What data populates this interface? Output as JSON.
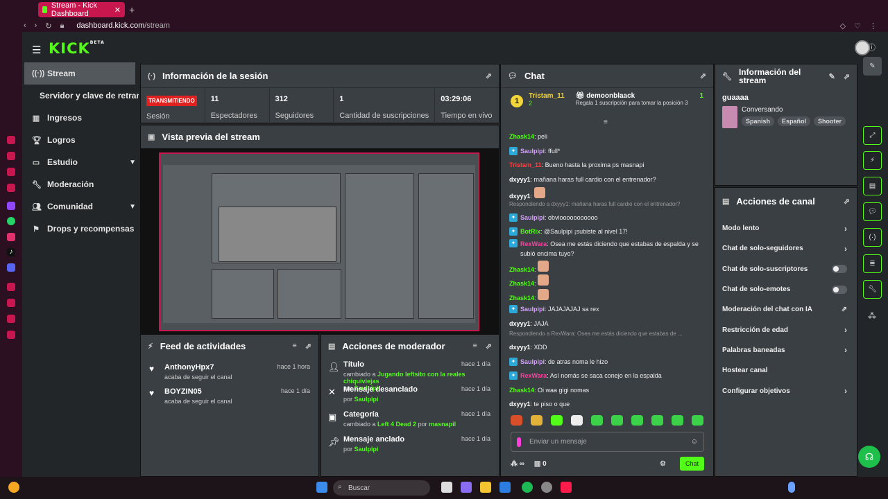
{
  "browser": {
    "tab_title": "Stream - Kick Dashboard",
    "url_host": "dashboard.kick.com",
    "url_path": "/stream"
  },
  "app": {
    "logo": "KICK",
    "logo_badge": "BETA"
  },
  "nav": {
    "stream": "Stream",
    "stream_sub": "Servidor y clave de retransmisión",
    "ingresos": "Ingresos",
    "logros": "Logros",
    "estudio": "Estudio",
    "moderacion": "Moderación",
    "comunidad": "Comunidad",
    "drops": "Drops y recompensas"
  },
  "session": {
    "title": "Información de la sesión",
    "live_badge": "TRANSMITIENDO",
    "live_label": "Sesión",
    "viewers": "11",
    "viewers_label": "Espectadores",
    "followers": "312",
    "followers_label": "Seguidores",
    "subs": "1",
    "subs_label": "Cantidad de suscripciones",
    "time": "03:29:06",
    "time_label": "Tiempo en vivo"
  },
  "preview": {
    "title": "Vista previa del stream"
  },
  "feed": {
    "title": "Feed de actividades",
    "items": [
      {
        "name": "AnthonyHpx7",
        "sub": "acaba de seguir el canal",
        "time": "hace 1 hora"
      },
      {
        "name": "BOYZIN05",
        "sub": "acaba de seguir el canal",
        "time": "hace 1 día"
      }
    ]
  },
  "modactions": {
    "title": "Acciones de moderador",
    "items": [
      {
        "title": "Título",
        "pre": "cambiado a ",
        "val": "Jugando leftsito con la reales chiquiviejas",
        "by": "Saulpipi",
        "time": "hace 1 día"
      },
      {
        "title": "Mensaje desanclado",
        "pre": "",
        "val": "",
        "by": "Saulpipi",
        "time": "hace 1 día"
      },
      {
        "title": "Categoría",
        "pre": "cambiado a ",
        "val": "Left 4 Dead 2",
        "by": "masnapil",
        "time": "hace 1 día"
      },
      {
        "title": "Mensaje anclado",
        "pre": "",
        "val": "",
        "by": "Saulpipi",
        "time": "hace 1 día"
      }
    ],
    "by_label": "por"
  },
  "chat": {
    "title": "Chat",
    "pinned": {
      "rank": "1",
      "user": "Tristam_11",
      "subcount": "2",
      "gifter": "demoonblaack",
      "gift_count": "1",
      "gift_text": "Regala 1 suscripción para tomar la posición 3"
    },
    "messages": [
      {
        "user": "Zhask14",
        "color": "#53fc18",
        "badge": false,
        "text": "peli"
      },
      {
        "user": "Saulpipi",
        "color": "#d6a0ff",
        "badge": true,
        "text": "ffull*"
      },
      {
        "user": "Tristam_11",
        "color": "#ff3f3f",
        "badge": false,
        "text": "Bueno hasta la proxima ps masnapi"
      },
      {
        "user": "dxyyy1",
        "color": "#ffffff",
        "badge": false,
        "text": "mañana haras full cardio con el entrenador?"
      },
      {
        "user": "dxyyy1",
        "color": "#ffffff",
        "badge": false,
        "text": "",
        "emote": true
      },
      {
        "reply": "Respondiendo a dxyyy1: mañana haras full cardio con el entrenador?"
      },
      {
        "user": "Saulpipi",
        "color": "#d6a0ff",
        "badge": true,
        "text": "obviooooooooooo"
      },
      {
        "user": "BotRix",
        "color": "#53fc18",
        "badge": true,
        "text": "@Saulpipi ¡subiste al nivel 17!"
      },
      {
        "user": "RexWara",
        "color": "#ff3fa0",
        "badge": true,
        "text": "Osea me estás diciendo que estabas de espalda y se subió encima tuyo?",
        "two": true
      },
      {
        "user": "Zhask14",
        "color": "#53fc18",
        "badge": false,
        "text": "",
        "emote": true
      },
      {
        "user": "Zhask14",
        "color": "#53fc18",
        "badge": false,
        "text": "",
        "emote": true
      },
      {
        "user": "Zhask14",
        "color": "#53fc18",
        "badge": false,
        "text": "",
        "emote": true
      },
      {
        "user": "Saulpipi",
        "color": "#d6a0ff",
        "badge": true,
        "text": "JAJAJAJAJ sa rex"
      },
      {
        "user": "dxyyy1",
        "color": "#ffffff",
        "badge": false,
        "text": "JAJA"
      },
      {
        "reply": "Respondiendo a RexWara: Osea me estás diciendo que estabas de ..."
      },
      {
        "user": "dxyyy1",
        "color": "#ffffff",
        "badge": false,
        "text": "XDD"
      },
      {
        "user": "Saulpipi",
        "color": "#d6a0ff",
        "badge": true,
        "text": "de atras noma le hizo"
      },
      {
        "user": "RexWara",
        "color": "#ff3fa0",
        "badge": true,
        "text": "Así nomás se saca conejo en la espalda"
      },
      {
        "user": "Zhask14",
        "color": "#53fc18",
        "badge": false,
        "text": "Oi waa gigi nomas"
      },
      {
        "user": "dxyyy1",
        "color": "#ffffff",
        "badge": false,
        "text": "te piso o que"
      }
    ],
    "input_placeholder": "Enviar un mensaje",
    "points": "0",
    "send_label": "Chat"
  },
  "streaminfo": {
    "title": "Información del stream",
    "stream_title": "guaaaa",
    "category": "Conversando",
    "tags": [
      "Spanish",
      "Español",
      "Shooter"
    ]
  },
  "channel_actions": {
    "title": "Acciones de canal",
    "items": [
      {
        "label": "Modo lento",
        "kind": "chev"
      },
      {
        "label": "Chat de solo-seguidores",
        "kind": "chev"
      },
      {
        "label": "Chat de solo-suscriptores",
        "kind": "toggle"
      },
      {
        "label": "Chat de solo-emotes",
        "kind": "toggle"
      },
      {
        "label": "Moderación del chat con IA",
        "kind": "ext"
      },
      {
        "label": "Restricción de edad",
        "kind": "chev"
      },
      {
        "label": "Palabras baneadas",
        "kind": "chev"
      },
      {
        "label": "Hostear canal",
        "kind": "none"
      },
      {
        "label": "Configurar objetivos",
        "kind": "chev"
      }
    ]
  },
  "taskbar": {
    "search_placeholder": "Buscar"
  },
  "colors": {
    "accent": "#53fc18",
    "live": "#e12020",
    "panel": "#3a3f43",
    "bg": "#232628"
  }
}
